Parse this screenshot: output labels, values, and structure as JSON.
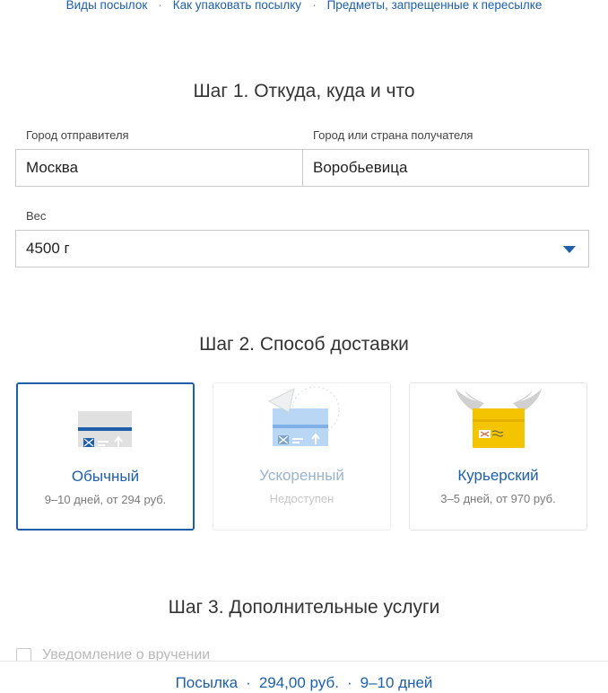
{
  "topnav": {
    "links": [
      "Виды посылок",
      "Как упаковать посылку",
      "Предметы, запрещенные к пересылке"
    ],
    "separator": "·"
  },
  "step1": {
    "title": "Шаг 1. Откуда, куда и что",
    "sender_label": "Город отправителя",
    "sender_value": "Москва",
    "receiver_label": "Город или страна получателя",
    "receiver_value": "Воробьевица",
    "weight_label": "Вес",
    "weight_value": "4500 г"
  },
  "step2": {
    "title": "Шаг 2. Способ доставки",
    "options": [
      {
        "name": "Обычный",
        "desc": "9–10 дней, от 294 руб.",
        "state": "selected"
      },
      {
        "name": "Ускоренный",
        "desc": "Недоступен",
        "state": "disabled"
      },
      {
        "name": "Курьерский",
        "desc": "3–5 дней, от 970 руб.",
        "state": "available"
      }
    ]
  },
  "step3": {
    "title": "Шаг 3. Дополнительные услуги",
    "checkbox_label": "Уведомление о вручении"
  },
  "summary": {
    "type": "Посылка",
    "price": "294,00 руб.",
    "duration": "9–10 дней",
    "separator": "·"
  },
  "colors": {
    "accent": "#1d5faa",
    "courier_yellow": "#f5c400"
  }
}
